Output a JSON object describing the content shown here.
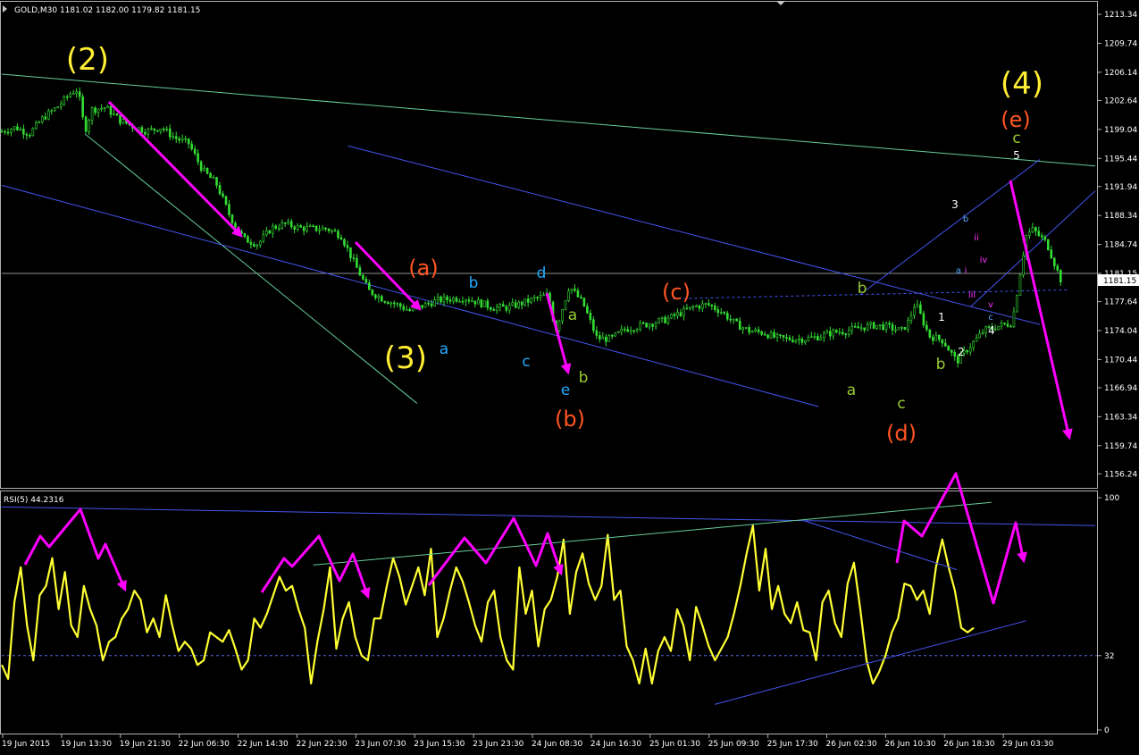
{
  "colors": {
    "background": "#000000",
    "candles": "#33dd33",
    "rsi_line": "#ffff33",
    "arrows": "#ff00ff",
    "channel_blue": "#4455ee",
    "trend_green": "#66cc99",
    "axis_text": "#ffffff",
    "frame": "#b0b0b0"
  },
  "chart_data": [
    {
      "type": "candlestick",
      "title": "GOLD,M30  1181.02 1182.00 1179.82 1181.15",
      "symbol": "GOLD",
      "timeframe": "M30",
      "ohlc": {
        "open": 1181.02,
        "high": 1182.0,
        "low": 1179.82,
        "close": 1181.15
      },
      "current_price_label": "1181.15",
      "current_price": 1181.15,
      "ylim": [
        1154.5,
        1214.9
      ],
      "y_ticks": [
        "1213.34",
        "1209.74",
        "1206.14",
        "1202.64",
        "1199.04",
        "1195.44",
        "1191.94",
        "1188.34",
        "1184.74",
        "1181.15",
        "1177.64",
        "1174.04",
        "1170.44",
        "1166.94",
        "1163.34",
        "1159.74",
        "1156.24"
      ],
      "y_tick_values": [
        1213.34,
        1209.74,
        1206.14,
        1202.64,
        1199.04,
        1195.44,
        1191.94,
        1188.34,
        1184.74,
        1181.15,
        1177.64,
        1174.04,
        1170.44,
        1166.94,
        1163.34,
        1159.74,
        1156.24
      ],
      "x_tick_labels": [
        "19 Jun 2015",
        "19 Jun 13:30",
        "19 Jun 21:30",
        "22 Jun 06:30",
        "22 Jun 14:30",
        "22 Jun 22:30",
        "23 Jun 07:30",
        "23 Jun 15:30",
        "23 Jun 23:30",
        "24 Jun 08:30",
        "24 Jun 16:30",
        "25 Jun 01:30",
        "25 Jun 09:30",
        "25 Jun 17:30",
        "26 Jun 02:30",
        "26 Jun 10:30",
        "26 Jun 18:30",
        "29 Jun 03:30"
      ],
      "price_path": [
        [
          0,
          1198.8
        ],
        [
          2,
          1199.3
        ],
        [
          4,
          1198.5
        ],
        [
          6,
          1200.5
        ],
        [
          8,
          1201.8
        ],
        [
          10,
          1203.6
        ],
        [
          11,
          1204.0
        ],
        [
          12,
          1198.8
        ],
        [
          13,
          1201.5
        ],
        [
          15,
          1201.8
        ],
        [
          17,
          1200.2
        ],
        [
          19,
          1199.4
        ],
        [
          21,
          1198.8
        ],
        [
          23,
          1199.3
        ],
        [
          25,
          1198.0
        ],
        [
          27,
          1197.3
        ],
        [
          29,
          1194.0
        ],
        [
          31,
          1192.3
        ],
        [
          33,
          1188.2
        ],
        [
          35,
          1185.4
        ],
        [
          37,
          1184.8
        ],
        [
          39,
          1186.8
        ],
        [
          41,
          1187.3
        ],
        [
          43,
          1186.8
        ],
        [
          45,
          1186.7
        ],
        [
          47,
          1186.7
        ],
        [
          49,
          1185.9
        ],
        [
          51,
          1182.3
        ],
        [
          53,
          1179.0
        ],
        [
          55,
          1178.0
        ],
        [
          57,
          1177.3
        ],
        [
          59,
          1176.5
        ],
        [
          61,
          1177.2
        ],
        [
          63,
          1177.8
        ],
        [
          65,
          1178.0
        ],
        [
          67,
          1178.1
        ],
        [
          69,
          1177.5
        ],
        [
          71,
          1176.9
        ],
        [
          73,
          1176.9
        ],
        [
          75,
          1177.4
        ],
        [
          77,
          1178.0
        ],
        [
          79,
          1178.5
        ],
        [
          80,
          1174.0
        ],
        [
          82,
          1179.6
        ],
        [
          84,
          1177.4
        ],
        [
          86,
          1173.1
        ],
        [
          88,
          1173.0
        ],
        [
          90,
          1174.2
        ],
        [
          92,
          1174.6
        ],
        [
          94,
          1175.0
        ],
        [
          96,
          1175.4
        ],
        [
          98,
          1176.2
        ],
        [
          100,
          1177.0
        ],
        [
          102,
          1177.3
        ],
        [
          104,
          1176.4
        ],
        [
          106,
          1174.9
        ],
        [
          108,
          1174.0
        ],
        [
          110,
          1173.8
        ],
        [
          112,
          1173.1
        ],
        [
          114,
          1173.0
        ],
        [
          116,
          1173.0
        ],
        [
          118,
          1173.3
        ],
        [
          120,
          1173.8
        ],
        [
          122,
          1174.0
        ],
        [
          124,
          1174.4
        ],
        [
          126,
          1174.7
        ],
        [
          128,
          1174.5
        ],
        [
          130,
          1174.0
        ],
        [
          131,
          1175.1
        ],
        [
          132,
          1177.5
        ],
        [
          134,
          1173.4
        ],
        [
          136,
          1172.8
        ],
        [
          138,
          1170.2
        ],
        [
          140,
          1172.2
        ],
        [
          142,
          1174.1
        ],
        [
          144,
          1174.6
        ],
        [
          146,
          1175.0
        ],
        [
          148,
          1185.8
        ],
        [
          149,
          1186.6
        ],
        [
          151,
          1184.9
        ],
        [
          153,
          1180.4
        ]
      ],
      "price_path_x_max": 158,
      "wave_labels": [
        {
          "text": "(2)",
          "color": "#ffee33",
          "size": "large"
        },
        {
          "text": "(3)",
          "color": "#ffee33",
          "size": "large"
        },
        {
          "text": "(4)",
          "color": "#ffee33",
          "size": "large"
        },
        {
          "text": "(a)",
          "color": "#ff5522",
          "size": "medium"
        },
        {
          "text": "(b)",
          "color": "#ff5522",
          "size": "medium"
        },
        {
          "text": "(c)",
          "color": "#ff5522",
          "size": "medium"
        },
        {
          "text": "(d)",
          "color": "#ff5522",
          "size": "medium"
        },
        {
          "text": "(e)",
          "color": "#ff5522",
          "size": "medium"
        },
        {
          "text": "a",
          "color": "#22aaff",
          "size": "small"
        },
        {
          "text": "b",
          "color": "#22aaff",
          "size": "small"
        },
        {
          "text": "c",
          "color": "#22aaff",
          "size": "small"
        },
        {
          "text": "d",
          "color": "#22aaff",
          "size": "small"
        },
        {
          "text": "e",
          "color": "#22aaff",
          "size": "small"
        },
        {
          "text": "a",
          "color": "#99cc33",
          "size": "small"
        },
        {
          "text": "b",
          "color": "#99cc33",
          "size": "small"
        },
        {
          "text": "a",
          "color": "#99cc33",
          "size": "small"
        },
        {
          "text": "b",
          "color": "#99cc33",
          "size": "small"
        },
        {
          "text": "c",
          "color": "#99cc33",
          "size": "small"
        },
        {
          "text": "b",
          "color": "#99cc33",
          "size": "small"
        },
        {
          "text": "c",
          "color": "#99cc33",
          "size": "small"
        },
        {
          "text": "1",
          "color": "#ffffff",
          "size": "tiny"
        },
        {
          "text": "2",
          "color": "#ffffff",
          "size": "tiny"
        },
        {
          "text": "3",
          "color": "#ffffff",
          "size": "tiny"
        },
        {
          "text": "4",
          "color": "#ffffff",
          "size": "tiny"
        },
        {
          "text": "5",
          "color": "#ffffff",
          "size": "tiny"
        },
        {
          "text": "a",
          "color": "#55aaff",
          "size": "micro"
        },
        {
          "text": "b",
          "color": "#55aaff",
          "size": "micro"
        },
        {
          "text": "c",
          "color": "#55aaff",
          "size": "micro"
        },
        {
          "text": "i",
          "color": "#ff33ff",
          "size": "micro"
        },
        {
          "text": "ii",
          "color": "#ff33ff",
          "size": "micro"
        },
        {
          "text": "iii",
          "color": "#ff33ff",
          "size": "micro"
        },
        {
          "text": "iv",
          "color": "#ff33ff",
          "size": "micro"
        },
        {
          "text": "v",
          "color": "#ff33ff",
          "size": "micro"
        }
      ]
    },
    {
      "type": "line",
      "title": "RSI(5) 44.2316",
      "indicator": "RSI",
      "period": 5,
      "current_value": 44.2316,
      "ylim": [
        0,
        100
      ],
      "y_ticks": [
        "100",
        "32",
        "0"
      ],
      "y_tick_values": [
        100,
        32,
        0
      ],
      "level_line": 32,
      "series": [
        {
          "name": "RSI(5)",
          "x_max": 158,
          "values": [
            28,
            22,
            55,
            70,
            45,
            30,
            58,
            62,
            74,
            52,
            68,
            45,
            40,
            62,
            52,
            45,
            30,
            38,
            40,
            48,
            52,
            60,
            56,
            42,
            48,
            40,
            58,
            45,
            34,
            38,
            35,
            28,
            30,
            42,
            40,
            38,
            43,
            35,
            26,
            30,
            48,
            44,
            50,
            58,
            66,
            60,
            62,
            52,
            44,
            20,
            38,
            52,
            70,
            35,
            48,
            55,
            40,
            32,
            30,
            48,
            48,
            62,
            74,
            66,
            54,
            62,
            70,
            58,
            78,
            40,
            48,
            60,
            70,
            64,
            55,
            45,
            38,
            55,
            60,
            40,
            30,
            26,
            70,
            50,
            60,
            36,
            52,
            56,
            66,
            82,
            50,
            68,
            76,
            63,
            56,
            62,
            84,
            56,
            60,
            36,
            30,
            20,
            35,
            20,
            34,
            40,
            34,
            52,
            45,
            30,
            53,
            45,
            36,
            30,
            35,
            40,
            50,
            62,
            76,
            88,
            60,
            78,
            52,
            62,
            50,
            46,
            55,
            43,
            42,
            30,
            55,
            60,
            46,
            40,
            63,
            72,
            52,
            30,
            20,
            25,
            32,
            42,
            48,
            63,
            62,
            56,
            60,
            50,
            70,
            82,
            70,
            60,
            44,
            42,
            44
          ]
        }
      ]
    }
  ]
}
